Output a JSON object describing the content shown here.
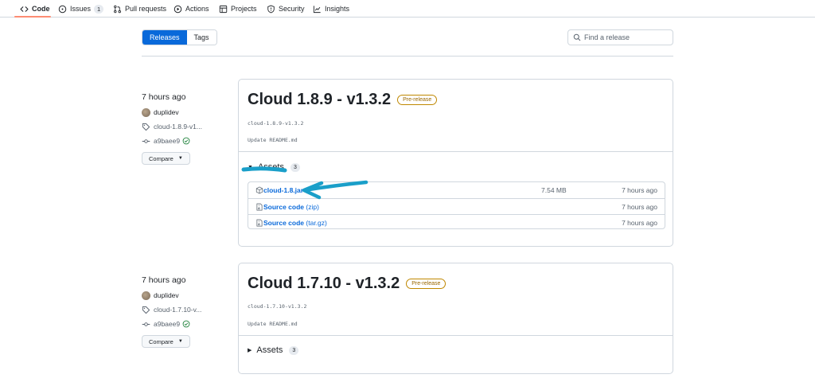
{
  "nav": {
    "tabs": [
      {
        "label": "Code",
        "icon": "code-icon",
        "active": true
      },
      {
        "label": "Issues",
        "icon": "issue-icon",
        "count": "1"
      },
      {
        "label": "Pull requests",
        "icon": "pull-request-icon"
      },
      {
        "label": "Actions",
        "icon": "play-icon"
      },
      {
        "label": "Projects",
        "icon": "table-icon"
      },
      {
        "label": "Security",
        "icon": "shield-icon"
      },
      {
        "label": "Insights",
        "icon": "graph-icon"
      }
    ],
    "active_color": "#fd8c73"
  },
  "subnav": {
    "releases_label": "Releases",
    "tags_label": "Tags",
    "search_placeholder": "Find a release"
  },
  "releases": [
    {
      "time": "7 hours ago",
      "author": "duplidev",
      "tag": "cloud-1.8.9-v1...",
      "commit": "a9baee9",
      "compare_label": "Compare",
      "title": "Cloud 1.8.9 - v1.3.2",
      "badge": "Pre-release",
      "tag_full": "cloud-1.8.9-v1.3.2",
      "body": "Update README.md",
      "assets_label": "Assets",
      "assets_count": "3",
      "assets_expanded": true,
      "assets": [
        {
          "icon": "package-icon",
          "name": "cloud-1.8.jar",
          "ext": "",
          "size": "7.54 MB",
          "time": "7 hours ago"
        },
        {
          "icon": "file-zip-icon",
          "name": "Source code",
          "ext": "(zip)",
          "size": "",
          "time": "7 hours ago"
        },
        {
          "icon": "file-zip-icon",
          "name": "Source code",
          "ext": "(tar.gz)",
          "size": "",
          "time": "7 hours ago"
        }
      ]
    },
    {
      "time": "7 hours ago",
      "author": "duplidev",
      "tag": "cloud-1.7.10-v...",
      "commit": "a9baee9",
      "compare_label": "Compare",
      "title": "Cloud 1.7.10 - v1.3.2",
      "badge": "Pre-release",
      "tag_full": "cloud-1.7.10-v1.3.2",
      "body": "Update README.md",
      "assets_label": "Assets",
      "assets_count": "3",
      "assets_expanded": false
    }
  ],
  "colors": {
    "accent": "#0969da",
    "border": "#d0d7de",
    "badge": "#bf8700",
    "annotation": "#1a9fc9",
    "check": "#1a7f37"
  }
}
